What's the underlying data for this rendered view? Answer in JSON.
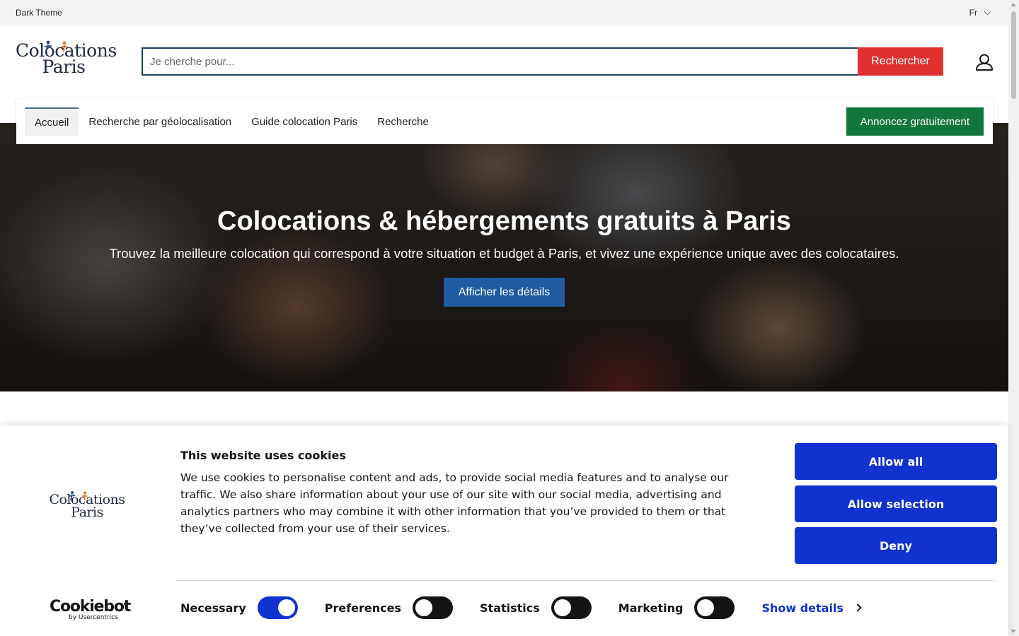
{
  "topbar": {
    "theme_label": "Dark Theme",
    "language": "Fr"
  },
  "header": {
    "logo_line1": "Colocations",
    "logo_line2": "Paris",
    "search_placeholder": "Je cherche pour...",
    "search_button": "Rechercher",
    "user_icon": "user-icon"
  },
  "nav": {
    "items": [
      {
        "label": "Accueil",
        "active": true
      },
      {
        "label": "Recherche par géolocalisation"
      },
      {
        "label": "Guide colocation Paris"
      },
      {
        "label": "Recherche"
      }
    ],
    "cta": "Annoncez gratuitement"
  },
  "hero": {
    "title": "Colocations & hébergements gratuits à Paris",
    "subtitle": "Trouvez la meilleure colocation qui correspond à votre situation et budget à Paris, et vivez une expérience unique avec des colocataires.",
    "button": "Afficher les détails"
  },
  "cookie": {
    "logo_line1": "Colocations",
    "logo_line2": "Paris",
    "title": "This website uses cookies",
    "body": "We use cookies to personalise content and ads, to provide social media features and to analyse our traffic. We also share information about your use of our site with our social media, advertising and analytics partners who may combine it with other information that you’ve provided to them or that they’ve collected from your use of their services.",
    "allow_all": "Allow all",
    "allow_selection": "Allow selection",
    "deny": "Deny",
    "brand_main": "Cookiebot",
    "brand_sub": "by Usercentrics",
    "toggles": [
      {
        "label": "Necessary",
        "on": true
      },
      {
        "label": "Preferences",
        "on": false
      },
      {
        "label": "Statistics",
        "on": false
      },
      {
        "label": "Marketing",
        "on": false
      }
    ],
    "show_details": "Show details"
  },
  "colors": {
    "search_button": "#e03131",
    "announce_button": "#13773b",
    "hero_button": "#215aa0",
    "cookie_button": "#1032cf"
  }
}
